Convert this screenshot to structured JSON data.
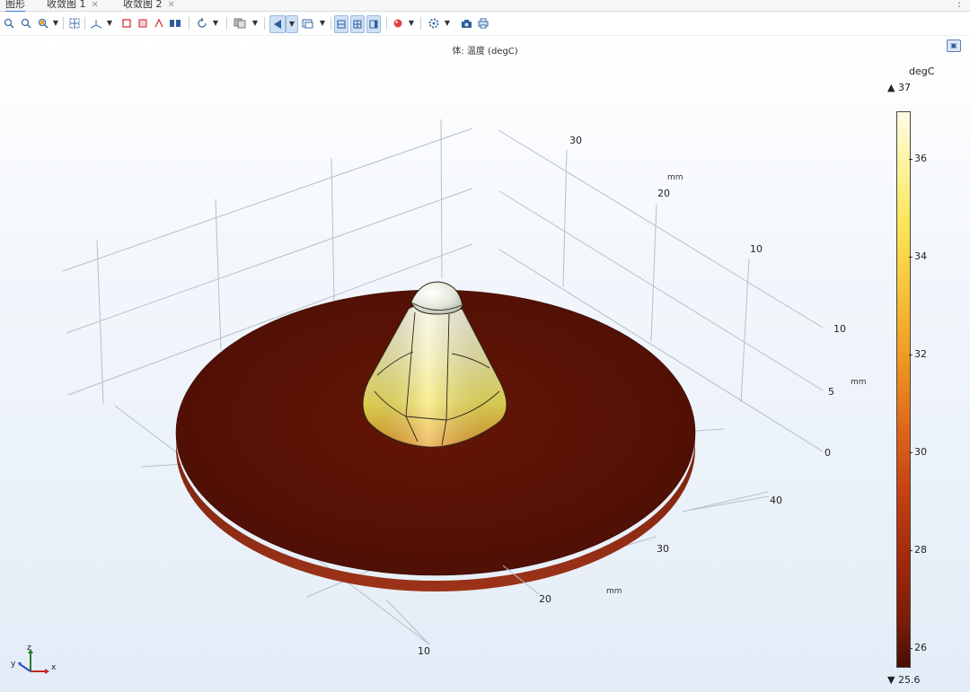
{
  "tabs": [
    {
      "label": "图形",
      "active": true
    },
    {
      "label": "收敛图 1",
      "close": "✕"
    },
    {
      "label": "收敛图 2",
      "close": "✕"
    }
  ],
  "tab_menu_icon": "⋮",
  "toolbar": {
    "icons": [
      "zoom-in-icon",
      "zoom-out-icon",
      "zoom-box-icon",
      "zoom-extents-icon",
      "axis-orientation-icon",
      "select-domain-icon",
      "select-boundary-icon",
      "select-edge-icon",
      "select-point-icon",
      "rotate-icon",
      "scene-light-icon",
      "transparency-icon",
      "view-icon",
      "wireframe-icon",
      "grid-icon",
      "axis-icon",
      "render-icon",
      "settings-icon",
      "camera-icon",
      "print-icon"
    ]
  },
  "plot": {
    "title": "体: 温度 (degC)",
    "axes": {
      "x_label_unit": "mm",
      "x_ticks": [
        "10",
        "20",
        "30",
        "40"
      ],
      "y_label_unit": "mm",
      "y_ticks": [
        "30",
        "20",
        "10"
      ],
      "z_label_unit": "mm",
      "z_ticks": [
        "10",
        "5",
        "0"
      ]
    },
    "triad": {
      "x": "x",
      "y": "y",
      "z": "z"
    }
  },
  "colorbar": {
    "unit": "degC",
    "max_label": "▲ 37",
    "min_label": "▼ 25.6",
    "ticks": [
      "36",
      "34",
      "32",
      "30",
      "28",
      "26"
    ],
    "colors": {
      "low": "#4a0d05",
      "high": "#fffbe8"
    }
  }
}
